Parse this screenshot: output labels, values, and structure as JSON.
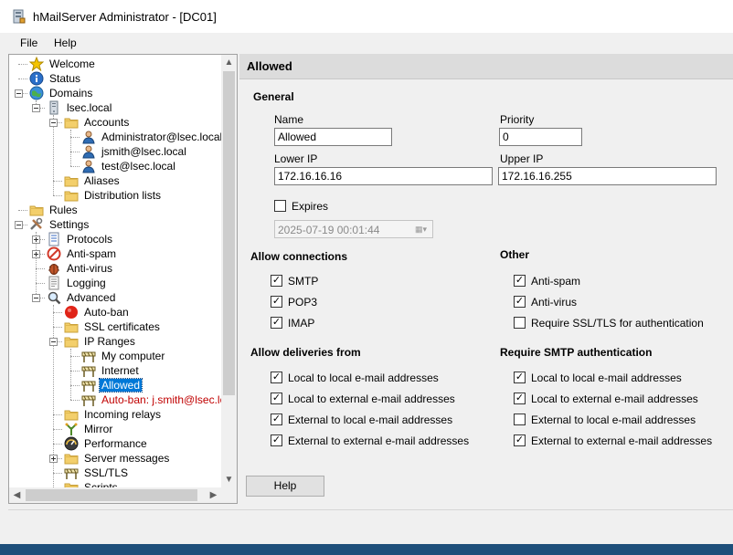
{
  "window": {
    "title": "hMailServer Administrator - [DC01]"
  },
  "menu": {
    "file": "File",
    "help": "Help"
  },
  "tree": {
    "items": [
      {
        "label": "Welcome",
        "icon": "star-icon",
        "indent": 1
      },
      {
        "label": "Status",
        "icon": "info-icon",
        "indent": 1
      },
      {
        "label": "Domains",
        "icon": "globe-icon",
        "indent": 1,
        "expander": "minus"
      },
      {
        "label": "lsec.local",
        "icon": "server-icon",
        "indent": 2,
        "expander": "minus"
      },
      {
        "label": "Accounts",
        "icon": "folder-icon",
        "indent": 3,
        "expander": "minus"
      },
      {
        "label": "Administrator@lsec.local",
        "icon": "user-icon",
        "indent": 4
      },
      {
        "label": "jsmith@lsec.local",
        "icon": "user-icon",
        "indent": 4
      },
      {
        "label": "test@lsec.local",
        "icon": "user-icon",
        "indent": 4
      },
      {
        "label": "Aliases",
        "icon": "folder-icon",
        "indent": 3
      },
      {
        "label": "Distribution lists",
        "icon": "folder-icon",
        "indent": 3
      },
      {
        "label": "Rules",
        "icon": "folder-icon",
        "indent": 1
      },
      {
        "label": "Settings",
        "icon": "tools-icon",
        "indent": 1,
        "expander": "minus"
      },
      {
        "label": "Protocols",
        "icon": "document-icon",
        "indent": 2,
        "expander": "plus"
      },
      {
        "label": "Anti-spam",
        "icon": "no-entry-icon",
        "indent": 2,
        "expander": "plus"
      },
      {
        "label": "Anti-virus",
        "icon": "bug-icon",
        "indent": 2
      },
      {
        "label": "Logging",
        "icon": "log-icon",
        "indent": 2
      },
      {
        "label": "Advanced",
        "icon": "magnifier-icon",
        "indent": 2,
        "expander": "minus"
      },
      {
        "label": "Auto-ban",
        "icon": "red-dot-icon",
        "indent": 3
      },
      {
        "label": "SSL certificates",
        "icon": "folder-icon",
        "indent": 3
      },
      {
        "label": "IP Ranges",
        "icon": "folder-icon",
        "indent": 3,
        "expander": "minus"
      },
      {
        "label": "My computer",
        "icon": "barrier-icon",
        "indent": 4
      },
      {
        "label": "Internet",
        "icon": "barrier-icon",
        "indent": 4
      },
      {
        "label": "Allowed",
        "icon": "barrier-icon",
        "indent": 4,
        "selected": true
      },
      {
        "label": "Auto-ban: j.smith@lsec.loca",
        "icon": "barrier-icon",
        "indent": 4,
        "red": true
      },
      {
        "label": "Incoming relays",
        "icon": "folder-icon",
        "indent": 3
      },
      {
        "label": "Mirror",
        "icon": "mirror-icon",
        "indent": 3
      },
      {
        "label": "Performance",
        "icon": "gauge-icon",
        "indent": 3
      },
      {
        "label": "Server messages",
        "icon": "folder-icon",
        "indent": 3,
        "expander": "plus"
      },
      {
        "label": "SSL/TLS",
        "icon": "barrier-icon",
        "indent": 3
      },
      {
        "label": "Scripts",
        "icon": "folder-icon",
        "indent": 3
      }
    ]
  },
  "page": {
    "title": "Allowed",
    "general": {
      "heading": "General",
      "name_label": "Name",
      "name_value": "Allowed",
      "priority_label": "Priority",
      "priority_value": "0",
      "lower_ip_label": "Lower IP",
      "lower_ip_value": "172.16.16.16",
      "upper_ip_label": "Upper IP",
      "upper_ip_value": "172.16.16.255",
      "expires_label": "Expires",
      "expires_checked": false,
      "expires_date": "2025-07-19 00:01:44"
    },
    "allow_connections": {
      "heading": "Allow connections",
      "items": [
        {
          "label": "SMTP",
          "checked": true
        },
        {
          "label": "POP3",
          "checked": true
        },
        {
          "label": "IMAP",
          "checked": true
        }
      ]
    },
    "other": {
      "heading": "Other",
      "items": [
        {
          "label": "Anti-spam",
          "checked": true
        },
        {
          "label": "Anti-virus",
          "checked": true
        },
        {
          "label": "Require SSL/TLS for authentication",
          "checked": false
        }
      ]
    },
    "allow_deliveries": {
      "heading": "Allow deliveries from",
      "items": [
        {
          "label": "Local to local e-mail addresses",
          "checked": true
        },
        {
          "label": "Local to external e-mail addresses",
          "checked": true
        },
        {
          "label": "External to local e-mail addresses",
          "checked": true
        },
        {
          "label": "External to external e-mail addresses",
          "checked": true
        }
      ]
    },
    "require_smtp_auth": {
      "heading": "Require SMTP authentication",
      "items": [
        {
          "label": "Local to local e-mail addresses",
          "checked": true
        },
        {
          "label": "Local to external e-mail addresses",
          "checked": true
        },
        {
          "label": "External to local e-mail addresses",
          "checked": false
        },
        {
          "label": "External to external e-mail addresses",
          "checked": true
        }
      ]
    },
    "help_button": "Help"
  },
  "colors": {
    "selection": "#0078d7",
    "autoban_text": "#c00000",
    "desktop": "#1e4f7a"
  }
}
